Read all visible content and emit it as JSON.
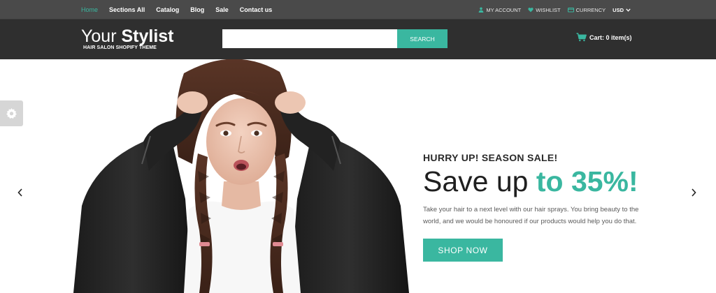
{
  "topbar": {
    "nav": [
      "Home",
      "Sections All",
      "Catalog",
      "Blog",
      "Sale",
      "Contact us"
    ],
    "my_account": "MY ACCOUNT",
    "wishlist": "WISHLIST",
    "currency": "CURRENCY",
    "currency_value": "USD"
  },
  "header": {
    "logo_light": "Your",
    "logo_bold": "Stylist",
    "logo_tagline": "HAIR SALON SHOPIFY THEME",
    "search_placeholder": "",
    "search_button": "SEARCH",
    "cart_label": "Cart: 0 item(s)"
  },
  "hero": {
    "eyebrow": "HURRY UP! SEASON SALE!",
    "headline_plain": "Save up",
    "headline_accent": "to 35%!",
    "body": "Take your hair to a next level with our hair sprays. You bring beauty to the world, and we would be honoured if our products would help you do that.",
    "cta": "SHOP NOW"
  },
  "colors": {
    "accent": "#3ab7a0",
    "topbar": "#4a4a4a",
    "header": "#2f2f2f"
  },
  "icons": [
    "user-icon",
    "heart-icon",
    "currency-icon",
    "chevron-down-icon",
    "cart-icon",
    "gear-icon",
    "chevron-left-icon",
    "chevron-right-icon"
  ]
}
